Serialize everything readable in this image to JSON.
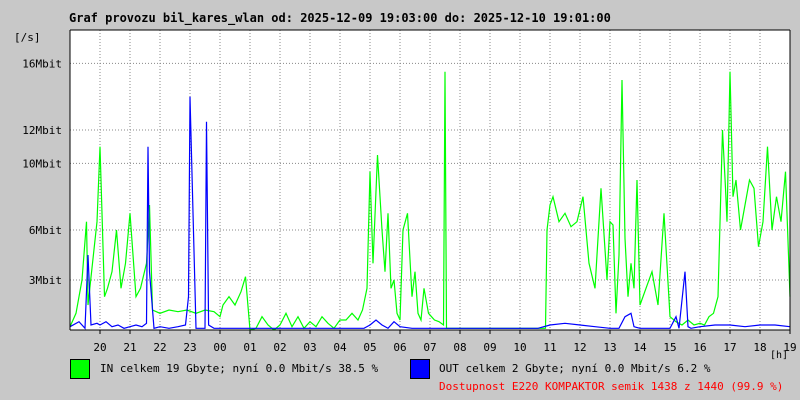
{
  "title": "Graf provozu bil_kares_wlan od: 2025-12-09 19:03:00 do: 2025-12-10 19:01:00",
  "y_unit_label": "[/s]",
  "x_unit_label": "[h]",
  "legend": {
    "in_text": "IN celkem 19 Gbyte; nyní   0.0 Mbit/s 38.5 %",
    "out_text": "OUT celkem 2 Gbyte; nyní   0.0 Mbit/s 6.2 %",
    "in_color": "#00ff00",
    "out_color": "#0000ff"
  },
  "status_text": "Dostupnost E220 KOMPAKTOR semik 1438 z 1440 (99.9 %)",
  "status_color": "#ff0000",
  "chart_data": {
    "type": "line",
    "title": "Graf provozu bil_kares_wlan od: 2025-12-09 19:03:00 do: 2025-12-10 19:01:00",
    "ylabel": "[/s]",
    "xlabel": "[h]",
    "x_range": [
      19,
      43
    ],
    "ylim": [
      0,
      18
    ],
    "grid": true,
    "y_ticks": [
      {
        "value": 3,
        "label": "3Mbit"
      },
      {
        "value": 6,
        "label": "6Mbit"
      },
      {
        "value": 10,
        "label": "10Mbit"
      },
      {
        "value": 12,
        "label": "12Mbit"
      },
      {
        "value": 16,
        "label": "16Mbit"
      }
    ],
    "x_ticks": [
      {
        "value": 20,
        "label": "20"
      },
      {
        "value": 21,
        "label": "21"
      },
      {
        "value": 22,
        "label": "22"
      },
      {
        "value": 23,
        "label": "23"
      },
      {
        "value": 24,
        "label": "00"
      },
      {
        "value": 25,
        "label": "01"
      },
      {
        "value": 26,
        "label": "02"
      },
      {
        "value": 27,
        "label": "03"
      },
      {
        "value": 28,
        "label": "04"
      },
      {
        "value": 29,
        "label": "05"
      },
      {
        "value": 30,
        "label": "06"
      },
      {
        "value": 31,
        "label": "07"
      },
      {
        "value": 32,
        "label": "08"
      },
      {
        "value": 33,
        "label": "09"
      },
      {
        "value": 34,
        "label": "10"
      },
      {
        "value": 35,
        "label": "11"
      },
      {
        "value": 36,
        "label": "12"
      },
      {
        "value": 37,
        "label": "13"
      },
      {
        "value": 38,
        "label": "14"
      },
      {
        "value": 39,
        "label": "15"
      },
      {
        "value": 40,
        "label": "16"
      },
      {
        "value": 41,
        "label": "17"
      },
      {
        "value": 42,
        "label": "18"
      },
      {
        "value": 43,
        "label": "19"
      }
    ],
    "series": [
      {
        "name": "IN",
        "color": "#00ff00",
        "x": [
          19.0,
          19.2,
          19.4,
          19.55,
          19.6,
          19.75,
          19.9,
          20.0,
          20.1,
          20.15,
          20.25,
          20.4,
          20.55,
          20.7,
          20.85,
          21.0,
          21.2,
          21.35,
          21.55,
          21.65,
          21.75,
          22.0,
          22.3,
          22.6,
          22.9,
          23.2,
          23.5,
          23.8,
          24.0,
          24.1,
          24.3,
          24.5,
          24.7,
          24.85,
          25.0,
          25.2,
          25.4,
          25.6,
          25.8,
          26.0,
          26.2,
          26.4,
          26.6,
          26.8,
          27.0,
          27.2,
          27.4,
          27.6,
          27.8,
          28.0,
          28.2,
          28.4,
          28.6,
          28.75,
          28.9,
          29.0,
          29.1,
          29.25,
          29.4,
          29.5,
          29.6,
          29.7,
          29.8,
          29.9,
          30.0,
          30.1,
          30.25,
          30.4,
          30.5,
          30.6,
          30.7,
          30.8,
          30.95,
          31.05,
          31.15,
          31.3,
          31.45,
          31.5,
          31.55,
          31.6,
          31.7,
          32.0,
          32.5,
          33.0,
          33.5,
          34.0,
          34.5,
          34.85,
          34.9,
          35.0,
          35.1,
          35.3,
          35.5,
          35.7,
          35.9,
          36.1,
          36.3,
          36.5,
          36.7,
          36.9,
          37.0,
          37.1,
          37.2,
          37.3,
          37.4,
          37.5,
          37.6,
          37.7,
          37.8,
          37.9,
          38.0,
          38.2,
          38.4,
          38.6,
          38.8,
          39.0,
          39.2,
          39.4,
          39.6,
          39.8,
          40.0,
          40.15,
          40.3,
          40.45,
          40.6,
          40.75,
          40.85,
          40.9,
          41.0,
          41.1,
          41.2,
          41.35,
          41.5,
          41.65,
          41.8,
          41.95,
          42.1,
          42.25,
          42.4,
          42.55,
          42.7,
          42.85,
          43.0
        ],
        "values": [
          0.2,
          1.0,
          3.0,
          6.5,
          1.5,
          4.0,
          6.5,
          11.0,
          5.0,
          2.0,
          2.5,
          3.5,
          6.0,
          2.5,
          4.0,
          7.0,
          2.0,
          2.5,
          4.0,
          7.5,
          1.2,
          1.0,
          1.2,
          1.1,
          1.2,
          1.0,
          1.2,
          1.1,
          0.8,
          1.5,
          2.0,
          1.5,
          2.3,
          3.2,
          0.0,
          0.1,
          0.8,
          0.3,
          0.0,
          0.3,
          1.0,
          0.2,
          0.8,
          0.1,
          0.5,
          0.2,
          0.8,
          0.4,
          0.1,
          0.6,
          0.6,
          1.0,
          0.6,
          1.2,
          2.5,
          9.5,
          4.0,
          10.5,
          6.0,
          3.5,
          7.0,
          2.5,
          3.0,
          1.0,
          0.6,
          6.0,
          7.0,
          2.0,
          3.5,
          1.0,
          0.6,
          2.5,
          1.0,
          0.8,
          0.6,
          0.5,
          0.3,
          15.5,
          0.1,
          0.1,
          0.1,
          0.1,
          0.1,
          0.1,
          0.1,
          0.1,
          0.1,
          0.1,
          6.0,
          7.5,
          8.0,
          6.5,
          7.0,
          6.2,
          6.5,
          8.0,
          4.0,
          2.5,
          8.5,
          3.0,
          6.5,
          6.3,
          1.0,
          4.5,
          15.0,
          5.5,
          2.0,
          4.0,
          2.5,
          9.0,
          1.5,
          2.5,
          3.5,
          1.5,
          7.0,
          0.8,
          0.5,
          0.3,
          0.6,
          0.3,
          0.4,
          0.3,
          0.8,
          1.0,
          2.0,
          12.0,
          8.5,
          6.5,
          15.5,
          8.0,
          9.0,
          6.0,
          7.5,
          9.0,
          8.5,
          5.0,
          6.5,
          11.0,
          6.0,
          8.0,
          6.5,
          9.5,
          2.0
        ]
      },
      {
        "name": "OUT",
        "color": "#0000ff",
        "x": [
          19.0,
          19.3,
          19.5,
          19.6,
          19.7,
          19.9,
          20.0,
          20.2,
          20.4,
          20.6,
          20.8,
          21.0,
          21.2,
          21.4,
          21.55,
          21.6,
          21.65,
          21.8,
          22.0,
          22.3,
          22.6,
          22.85,
          22.95,
          23.0,
          23.2,
          23.5,
          23.55,
          23.62,
          23.8,
          24.0,
          24.5,
          25.0,
          26.0,
          27.0,
          28.0,
          28.8,
          29.0,
          29.2,
          29.4,
          29.6,
          29.8,
          30.0,
          30.4,
          30.8,
          31.5,
          32.0,
          33.0,
          34.0,
          34.6,
          35.0,
          35.5,
          36.0,
          36.5,
          37.0,
          37.3,
          37.5,
          37.7,
          37.8,
          38.0,
          38.5,
          39.0,
          39.2,
          39.3,
          39.5,
          39.6,
          39.7,
          40.0,
          40.5,
          41.0,
          41.5,
          42.0,
          42.5,
          43.0
        ],
        "values": [
          0.2,
          0.5,
          0.1,
          4.5,
          0.3,
          0.4,
          0.3,
          0.5,
          0.2,
          0.3,
          0.1,
          0.2,
          0.3,
          0.2,
          0.4,
          11.0,
          3.5,
          0.1,
          0.2,
          0.1,
          0.2,
          0.3,
          2.0,
          14.0,
          0.1,
          0.1,
          12.5,
          0.3,
          0.1,
          0.1,
          0.1,
          0.1,
          0.1,
          0.1,
          0.1,
          0.1,
          0.3,
          0.6,
          0.3,
          0.1,
          0.5,
          0.2,
          0.1,
          0.1,
          0.1,
          0.1,
          0.1,
          0.1,
          0.1,
          0.3,
          0.4,
          0.3,
          0.2,
          0.1,
          0.1,
          0.8,
          1.0,
          0.2,
          0.1,
          0.1,
          0.1,
          0.8,
          0.1,
          3.5,
          0.2,
          0.1,
          0.2,
          0.3,
          0.3,
          0.2,
          0.3,
          0.3,
          0.2
        ]
      }
    ]
  }
}
